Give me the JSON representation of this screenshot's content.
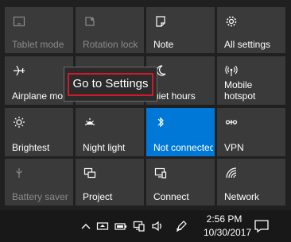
{
  "action_center": {
    "tiles": [
      {
        "label": "Tablet mode",
        "icon": "tablet-mode-icon",
        "state": "disabled"
      },
      {
        "label": "Rotation lock",
        "icon": "rotation-lock-icon",
        "state": "disabled"
      },
      {
        "label": "Note",
        "icon": "note-icon",
        "state": "normal"
      },
      {
        "label": "All settings",
        "icon": "gear-icon",
        "state": "normal"
      },
      {
        "label": "Airplane mo",
        "icon": "airplane-icon",
        "state": "normal"
      },
      {
        "label": "",
        "icon": "location-icon",
        "state": "normal"
      },
      {
        "label": "uiet hours",
        "icon": "moon-icon",
        "state": "normal"
      },
      {
        "label": "Mobile hotspot",
        "label_line1": "Mobile",
        "label_line2": "hotspot",
        "icon": "hotspot-icon",
        "state": "normal"
      },
      {
        "label": "Brightest",
        "icon": "brightness-icon",
        "state": "normal"
      },
      {
        "label": "Night light",
        "icon": "night-light-icon",
        "state": "normal"
      },
      {
        "label": "Not connected",
        "icon": "bluetooth-icon",
        "state": "active"
      },
      {
        "label": "VPN",
        "icon": "vpn-icon",
        "state": "normal"
      },
      {
        "label": "Battery saver",
        "icon": "battery-saver-icon",
        "state": "disabled"
      },
      {
        "label": "Project",
        "icon": "project-icon",
        "state": "normal"
      },
      {
        "label": "Connect",
        "icon": "connect-icon",
        "state": "normal"
      },
      {
        "label": "Network",
        "icon": "network-icon",
        "state": "normal"
      }
    ],
    "accent_color": "#0078d7"
  },
  "tooltip": {
    "text": "Go to Settings",
    "highlight_color": "#d0192b"
  },
  "taskbar": {
    "time": "2:56 PM",
    "date": "10/30/2017",
    "tray_icons": [
      "show-hidden-icons-icon",
      "projector-icon",
      "battery-icon",
      "network-icon",
      "volume-icon",
      "pen-icon"
    ]
  }
}
